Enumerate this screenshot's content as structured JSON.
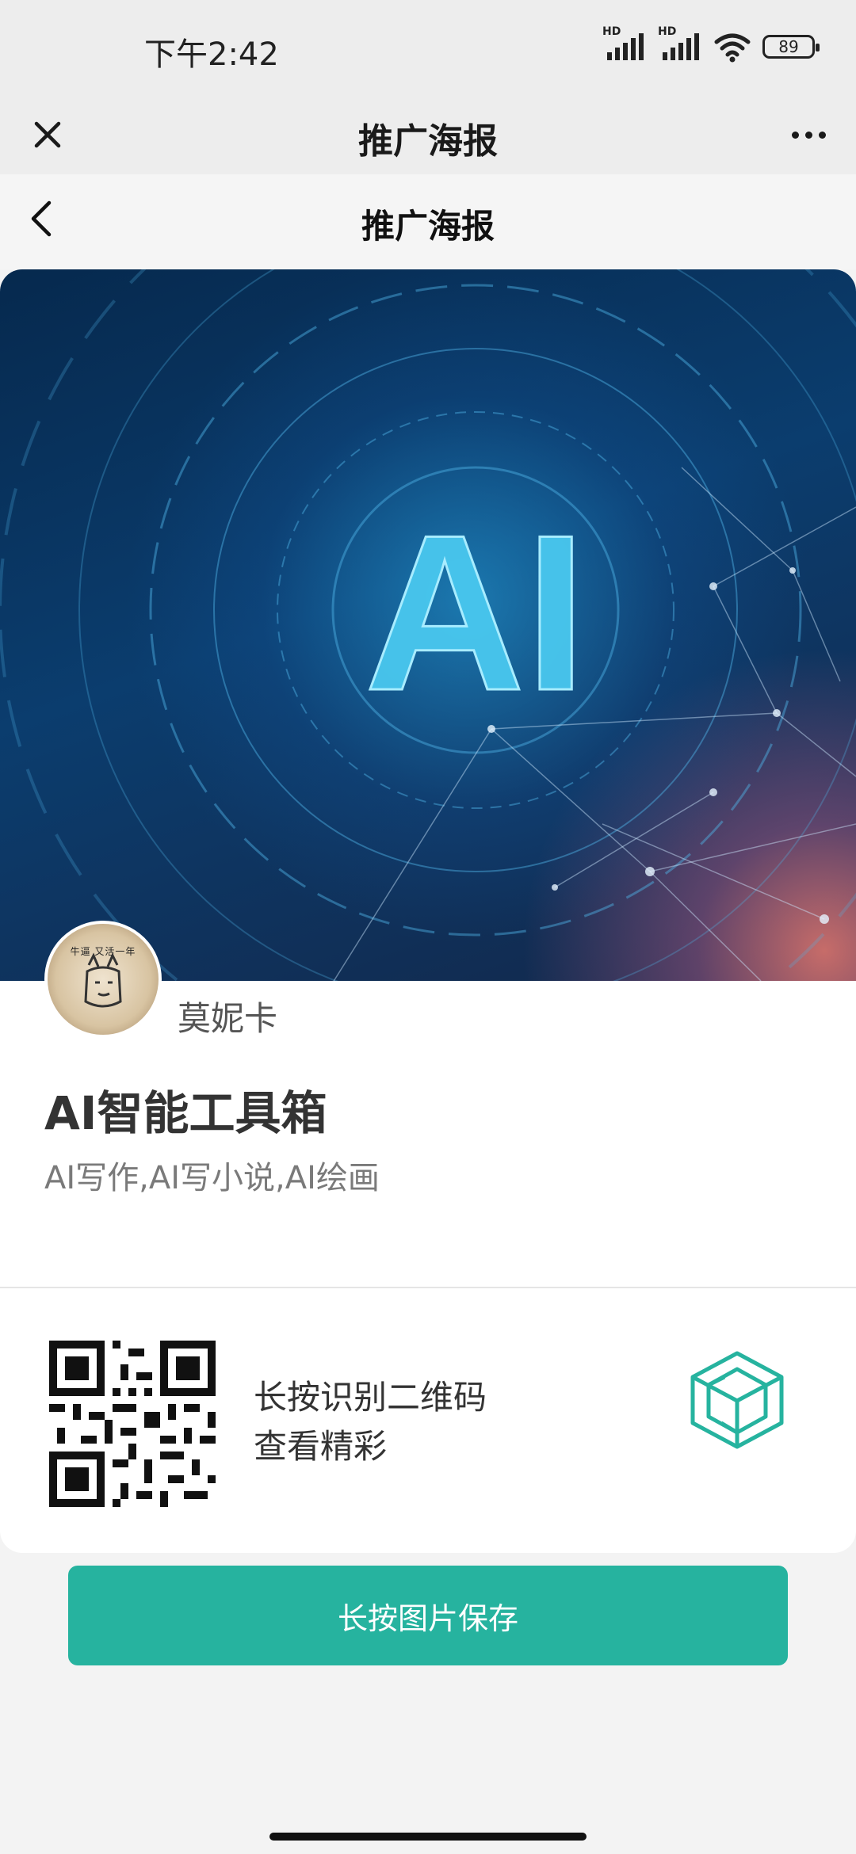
{
  "status_bar": {
    "time": "下午2:42",
    "signal_1_tag": "HD",
    "signal_2_tag": "HD",
    "battery": "89"
  },
  "outer_nav": {
    "title": "推广海报",
    "close_icon": "close-icon",
    "more_icon": "more-icon"
  },
  "inner_nav": {
    "title": "推广海报",
    "back_icon": "back-icon"
  },
  "poster": {
    "hero_text": "AI",
    "avatar_text": "牛逼 又活一年",
    "author_name": "莫妮卡",
    "title": "AI智能工具箱",
    "subtitle": "AI写作,AI写小说,AI绘画",
    "qr_line_1": "长按识别二维码",
    "qr_line_2": "查看精彩"
  },
  "save_button_label": "长按图片保存",
  "colors": {
    "accent": "#26b39f",
    "nav_bg": "#ededed"
  }
}
